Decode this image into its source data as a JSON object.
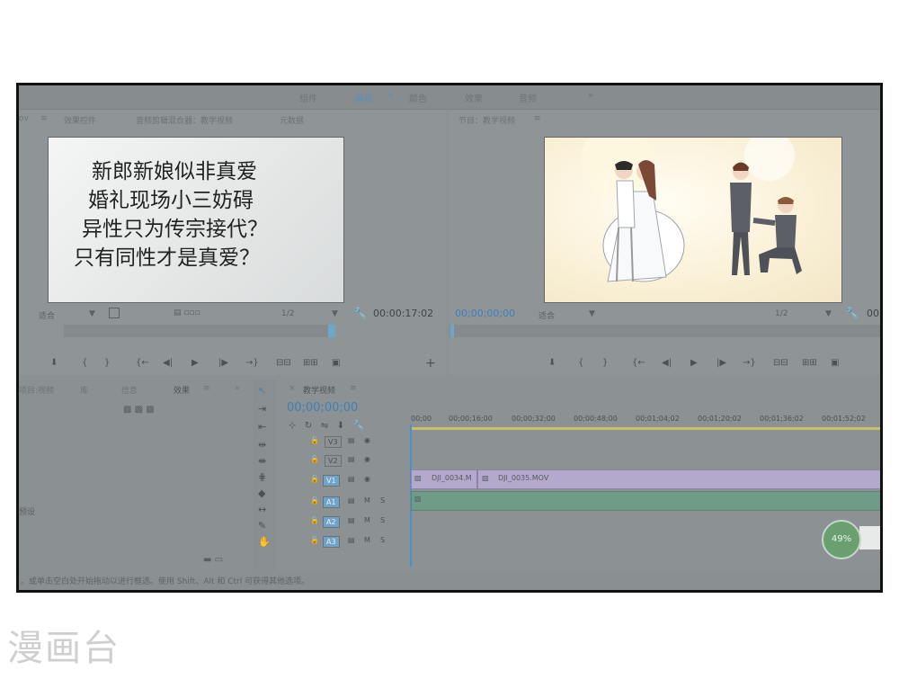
{
  "workspace_tabs": [
    "组件",
    "编辑",
    "≡",
    "颜色",
    "效果",
    "音频",
    "»"
  ],
  "source_panel": {
    "tabs": [
      "ov",
      "≡",
      "效果控件",
      "音频剪辑混合器：教学视频",
      "元数据"
    ],
    "image_lines": [
      "新郎新娘似非真爱",
      "婚礼现场小三妨碍",
      "异性只为传宗接代？",
      "只有同性才是真爱？"
    ],
    "fit_label": "适合",
    "resolution": "1/2",
    "timecode": "00:00:17:02"
  },
  "program_panel": {
    "title": "节目：教学视频",
    "menu_icon": "≡",
    "timecode": "00;00;00;00",
    "fit_label": "适合",
    "resolution": "1/2",
    "timecode_right": "00"
  },
  "project_panel": {
    "tabs": [
      "项目:视频",
      "库",
      "信息",
      "效果",
      "≡",
      "»"
    ],
    "side_label": "预设"
  },
  "timeline": {
    "title": "教学视频",
    "close": "×",
    "menu_icon": "≡",
    "timecode": "00;00;00;00",
    "ruler": [
      "00;00",
      "00;00;16;00",
      "00;00;32;00",
      "00;00;48;00",
      "00;01;04;02",
      "00;01;20;02",
      "00;01;36;02",
      "00;01;52;02"
    ],
    "video_tracks": [
      "V3",
      "V2",
      "V1"
    ],
    "audio_tracks": [
      "A1",
      "A2",
      "A3"
    ],
    "track_flag_m": "M",
    "track_flag_s": "S",
    "clip_1": "DJI_0034.M",
    "clip_2": "DJI_0035.MOV"
  },
  "status_text": "。或单击空白处开始拖动以进行框选。使用 Shift、Alt 和 Ctrl 可获得其他选项。",
  "badge_percent": "49%",
  "watermark": "漫画台",
  "colors": {
    "accent": "#5e90b8",
    "audio_clip": "#6ea088",
    "video_clip": "#b8acd4",
    "playhead": "#4d8ed0"
  }
}
